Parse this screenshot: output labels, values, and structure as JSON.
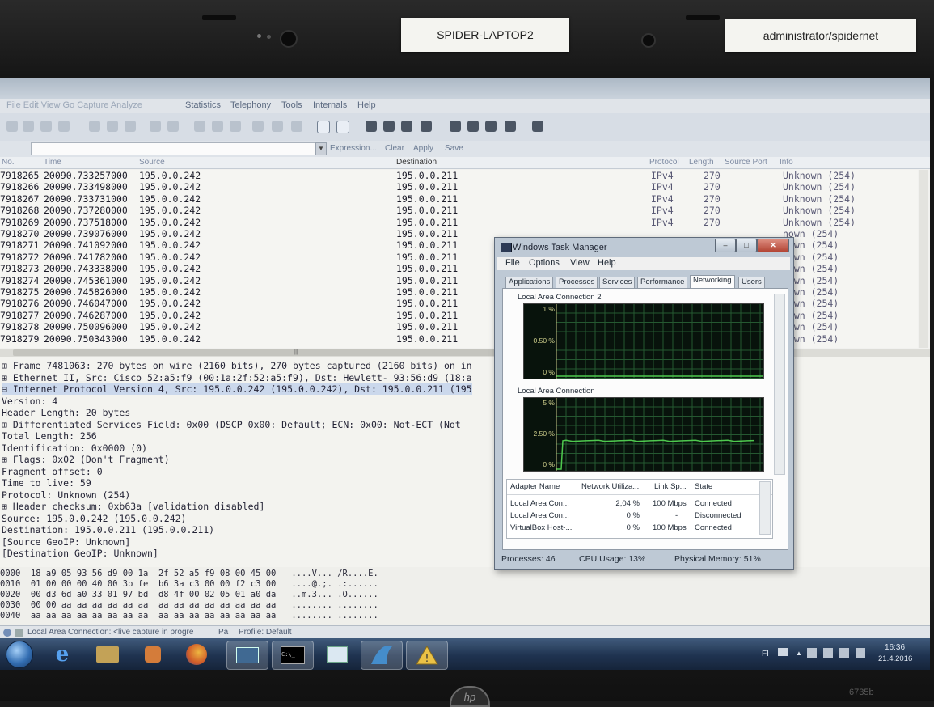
{
  "labels": {
    "hostname": "SPIDER-LAPTOP2",
    "credentials": "administrator/spidernet",
    "model": "6735b",
    "hp": "hp"
  },
  "wireshark": {
    "menu": [
      "Statistics",
      "Telephony",
      "Tools",
      "Internals",
      "Help"
    ],
    "filter_bar": {
      "expression": "Expression...",
      "clear": "Clear",
      "apply": "Apply",
      "save": "Save"
    },
    "columns": {
      "no": "No.",
      "time": "Time",
      "source": "Source",
      "destination": "Destination",
      "protocol": "Protocol",
      "length": "Length",
      "source_port": "Source Port",
      "info": "Info"
    },
    "rows": [
      {
        "no": "7918265",
        "time": "20090.733257000",
        "source": "195.0.0.242",
        "destination": "195.0.0.211",
        "protocol": "IPv4",
        "length": "270",
        "info": "Unknown (254)"
      },
      {
        "no": "7918266",
        "time": "20090.733498000",
        "source": "195.0.0.242",
        "destination": "195.0.0.211",
        "protocol": "IPv4",
        "length": "270",
        "info": "Unknown (254)"
      },
      {
        "no": "7918267",
        "time": "20090.733731000",
        "source": "195.0.0.242",
        "destination": "195.0.0.211",
        "protocol": "IPv4",
        "length": "270",
        "info": "Unknown (254)"
      },
      {
        "no": "7918268",
        "time": "20090.737280000",
        "source": "195.0.0.242",
        "destination": "195.0.0.211",
        "protocol": "IPv4",
        "length": "270",
        "info": "Unknown (254)"
      },
      {
        "no": "7918269",
        "time": "20090.737518000",
        "source": "195.0.0.242",
        "destination": "195.0.0.211",
        "protocol": "IPv4",
        "length": "270",
        "info": "Unknown (254)"
      },
      {
        "no": "7918270",
        "time": "20090.739076000",
        "source": "195.0.0.242",
        "destination": "195.0.0.211",
        "protocol": "",
        "length": "",
        "info": "nown (254)"
      },
      {
        "no": "7918271",
        "time": "20090.741092000",
        "source": "195.0.0.242",
        "destination": "195.0.0.211",
        "protocol": "",
        "length": "",
        "info": "nown (254)"
      },
      {
        "no": "7918272",
        "time": "20090.741782000",
        "source": "195.0.0.242",
        "destination": "195.0.0.211",
        "protocol": "",
        "length": "",
        "info": "nown (254)"
      },
      {
        "no": "7918273",
        "time": "20090.743338000",
        "source": "195.0.0.242",
        "destination": "195.0.0.211",
        "protocol": "",
        "length": "",
        "info": "nown (254)"
      },
      {
        "no": "7918274",
        "time": "20090.745361000",
        "source": "195.0.0.242",
        "destination": "195.0.0.211",
        "protocol": "",
        "length": "",
        "info": "nown (254)"
      },
      {
        "no": "7918275",
        "time": "20090.745826000",
        "source": "195.0.0.242",
        "destination": "195.0.0.211",
        "protocol": "",
        "length": "",
        "info": "nown (254)"
      },
      {
        "no": "7918276",
        "time": "20090.746047000",
        "source": "195.0.0.242",
        "destination": "195.0.0.211",
        "protocol": "",
        "length": "",
        "info": "nown (254)"
      },
      {
        "no": "7918277",
        "time": "20090.746287000",
        "source": "195.0.0.242",
        "destination": "195.0.0.211",
        "protocol": "",
        "length": "",
        "info": "nown (254)"
      },
      {
        "no": "7918278",
        "time": "20090.750096000",
        "source": "195.0.0.242",
        "destination": "195.0.0.211",
        "protocol": "",
        "length": "",
        "info": "nown (254)"
      },
      {
        "no": "7918279",
        "time": "20090.750343000",
        "source": "195.0.0.242",
        "destination": "195.0.0.211",
        "protocol": "",
        "length": "",
        "info": "nown (254)"
      }
    ],
    "details": [
      "⊞ Frame 7481063: 270 bytes on wire (2160 bits), 270 bytes captured (2160 bits) on in",
      "⊞ Ethernet II, Src: Cisco_52:a5:f9 (00:1a:2f:52:a5:f9), Dst: Hewlett-_93:56:d9 (18:a",
      "⊟ Internet Protocol Version 4, Src: 195.0.0.242 (195.0.0.242), Dst: 195.0.0.211 (195",
      "    Version: 4",
      "    Header Length: 20 bytes",
      "  ⊞ Differentiated Services Field: 0x00 (DSCP 0x00: Default; ECN: 0x00: Not-ECT (Not",
      "    Total Length: 256",
      "    Identification: 0x0000 (0)",
      "  ⊞ Flags: 0x02 (Don't Fragment)",
      "    Fragment offset: 0",
      "    Time to live: 59",
      "    Protocol: Unknown (254)",
      "  ⊞ Header checksum: 0xb63a [validation disabled]",
      "    Source: 195.0.0.242 (195.0.0.242)",
      "    Destination: 195.0.0.211 (195.0.0.211)",
      "    [Source GeoIP: Unknown]",
      "    [Destination GeoIP: Unknown]"
    ],
    "hex": [
      "0000  18 a9 05 93 56 d9 00 1a  2f 52 a5 f9 08 00 45 00   ....V... /R....E.",
      "0010  01 00 00 00 40 00 3b fe  b6 3a c3 00 00 f2 c3 00   ....@.;. .:......",
      "0020  00 d3 6d a0 33 01 97 bd  d8 4f 00 02 05 01 a0 da   ..m.3... .O......",
      "0030  00 00 aa aa aa aa aa aa  aa aa aa aa aa aa aa aa   ........ ........",
      "0040  aa aa aa aa aa aa aa aa  aa aa aa aa aa aa aa aa   ........ ........"
    ],
    "status": {
      "capture": "Local Area Connection: <live capture in progre",
      "packets": "Pa",
      "profile": "Profile: Default"
    }
  },
  "taskmanager": {
    "title": "Windows Task Manager",
    "menu": [
      "File",
      "Options",
      "View",
      "Help"
    ],
    "tabs": [
      "Applications",
      "Processes",
      "Services",
      "Performance",
      "Networking",
      "Users"
    ],
    "active_tab": "Networking",
    "graph1": {
      "label": "Local Area Connection 2",
      "ticks": [
        "1 %",
        "0.50 %",
        "0 %"
      ]
    },
    "graph2": {
      "label": "Local Area Connection",
      "ticks": [
        "5 %",
        "2.50 %",
        "0 %"
      ],
      "level_percent": 2.04
    },
    "table": {
      "headers": [
        "Adapter Name",
        "Network Utiliza...",
        "Link Sp...",
        "State"
      ],
      "rows": [
        {
          "name": "Local Area Con...",
          "util": "2,04 %",
          "speed": "100 Mbps",
          "state": "Connected"
        },
        {
          "name": "Local Area Con...",
          "util": "0 %",
          "speed": "-",
          "state": "Disconnected"
        },
        {
          "name": "VirtualBox Host-...",
          "util": "0 %",
          "speed": "100 Mbps",
          "state": "Connected"
        }
      ]
    },
    "status": {
      "processes": "Processes: 46",
      "cpu": "CPU Usage: 13%",
      "memory": "Physical Memory: 51%"
    }
  },
  "taskbar": {
    "lang": "FI",
    "time": "16:36",
    "date": "21.4.2016"
  },
  "colors": {
    "accent": "#2a4f86",
    "graph_line": "#3fcf3f",
    "graph_bg": "#06140b"
  }
}
